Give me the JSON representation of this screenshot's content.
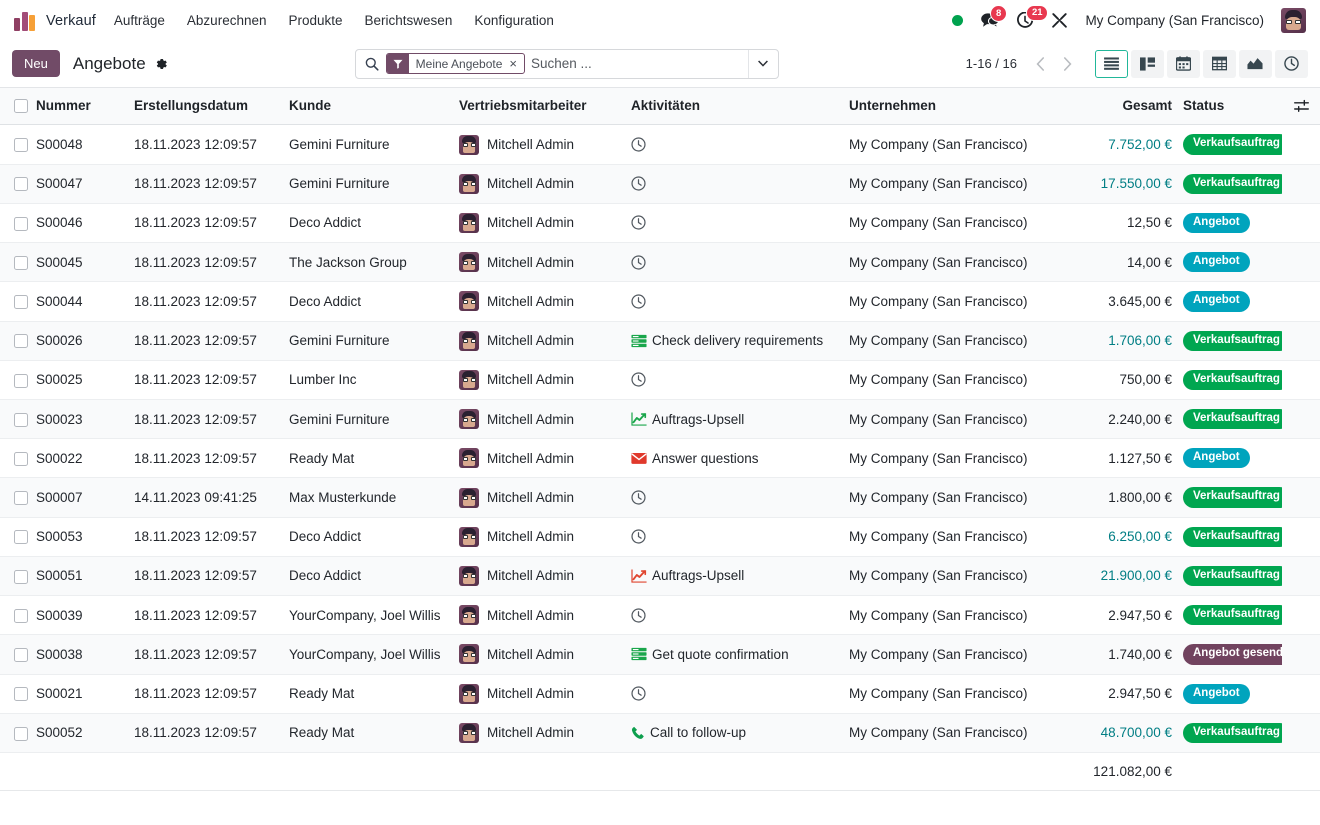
{
  "navbar": {
    "app_name": "Verkauf",
    "menu_items": [
      {
        "label": "Aufträge"
      },
      {
        "label": "Abzurechnen"
      },
      {
        "label": "Produkte"
      },
      {
        "label": "Berichtswesen"
      },
      {
        "label": "Konfiguration"
      }
    ],
    "status_dot_color": "#00a24e",
    "messages_count": "8",
    "activities_count": "21",
    "company": "My Company (San Francisco)"
  },
  "control_panel": {
    "new_button": "Neu",
    "title": "Angebote",
    "search": {
      "facet_label": "Meine Angebote",
      "facet_remove": "×",
      "placeholder": "Suchen ..."
    },
    "pager": "1-16 / 16",
    "views": [
      {
        "name": "list",
        "active": true
      },
      {
        "name": "kanban",
        "active": false
      },
      {
        "name": "calendar",
        "active": false
      },
      {
        "name": "pivot",
        "active": false
      },
      {
        "name": "graph",
        "active": false
      },
      {
        "name": "activity",
        "active": false
      }
    ]
  },
  "table": {
    "headers": {
      "number": "Nummer",
      "date": "Erstellungsdatum",
      "customer": "Kunde",
      "salesperson": "Vertriebsmitarbeiter",
      "activities": "Aktivitäten",
      "company": "Unternehmen",
      "total": "Gesamt",
      "status": "Status"
    },
    "rows": [
      {
        "number": "S00048",
        "date": "18.11.2023 12:09:57",
        "customer": "Gemini Furniture",
        "salesperson": "Mitchell Admin",
        "activity_icon": "clock-icon",
        "activity_label": "",
        "company": "My Company (San Francisco)",
        "total": "7.752,00 €",
        "total_color": "teal",
        "status": "Verkaufsauftrag",
        "status_kind": "sale"
      },
      {
        "number": "S00047",
        "date": "18.11.2023 12:09:57",
        "customer": "Gemini Furniture",
        "salesperson": "Mitchell Admin",
        "activity_icon": "clock-icon",
        "activity_label": "",
        "company": "My Company (San Francisco)",
        "total": "17.550,00 €",
        "total_color": "teal",
        "status": "Verkaufsauftrag",
        "status_kind": "sale"
      },
      {
        "number": "S00046",
        "date": "18.11.2023 12:09:57",
        "customer": "Deco Addict",
        "salesperson": "Mitchell Admin",
        "activity_icon": "clock-icon",
        "activity_label": "",
        "company": "My Company (San Francisco)",
        "total": "12,50 €",
        "total_color": "dark",
        "status": "Angebot",
        "status_kind": "quote"
      },
      {
        "number": "S00045",
        "date": "18.11.2023 12:09:57",
        "customer": "The Jackson Group",
        "salesperson": "Mitchell Admin",
        "activity_icon": "clock-icon",
        "activity_label": "",
        "company": "My Company (San Francisco)",
        "total": "14,00 €",
        "total_color": "dark",
        "status": "Angebot",
        "status_kind": "quote"
      },
      {
        "number": "S00044",
        "date": "18.11.2023 12:09:57",
        "customer": "Deco Addict",
        "salesperson": "Mitchell Admin",
        "activity_icon": "clock-icon",
        "activity_label": "",
        "company": "My Company (San Francisco)",
        "total": "3.645,00 €",
        "total_color": "dark",
        "status": "Angebot",
        "status_kind": "quote"
      },
      {
        "number": "S00026",
        "date": "18.11.2023 12:09:57",
        "customer": "Gemini Furniture",
        "salesperson": "Mitchell Admin",
        "activity_icon": "todo-list-icon-green",
        "activity_label": "Check delivery requirements",
        "company": "My Company (San Francisco)",
        "total": "1.706,00 €",
        "total_color": "teal",
        "status": "Verkaufsauftrag",
        "status_kind": "sale"
      },
      {
        "number": "S00025",
        "date": "18.11.2023 12:09:57",
        "customer": "Lumber Inc",
        "salesperson": "Mitchell Admin",
        "activity_icon": "clock-icon",
        "activity_label": "",
        "company": "My Company (San Francisco)",
        "total": "750,00 €",
        "total_color": "dark",
        "status": "Verkaufsauftrag",
        "status_kind": "sale"
      },
      {
        "number": "S00023",
        "date": "18.11.2023 12:09:57",
        "customer": "Gemini Furniture",
        "salesperson": "Mitchell Admin",
        "activity_icon": "upsell-chart-icon-green",
        "activity_label": "Auftrags-Upsell",
        "company": "My Company (San Francisco)",
        "total": "2.240,00 €",
        "total_color": "dark",
        "status": "Verkaufsauftrag",
        "status_kind": "sale"
      },
      {
        "number": "S00022",
        "date": "18.11.2023 12:09:57",
        "customer": "Ready Mat",
        "salesperson": "Mitchell Admin",
        "activity_icon": "email-icon-red",
        "activity_label": "Answer questions",
        "company": "My Company (San Francisco)",
        "total": "1.127,50 €",
        "total_color": "dark",
        "status": "Angebot",
        "status_kind": "quote"
      },
      {
        "number": "S00007",
        "date": "14.11.2023 09:41:25",
        "customer": "Max Musterkunde",
        "salesperson": "Mitchell Admin",
        "activity_icon": "clock-icon",
        "activity_label": "",
        "company": "My Company (San Francisco)",
        "total": "1.800,00 €",
        "total_color": "dark",
        "status": "Verkaufsauftrag",
        "status_kind": "sale"
      },
      {
        "number": "S00053",
        "date": "18.11.2023 12:09:57",
        "customer": "Deco Addict",
        "salesperson": "Mitchell Admin",
        "activity_icon": "clock-icon",
        "activity_label": "",
        "company": "My Company (San Francisco)",
        "total": "6.250,00 €",
        "total_color": "teal",
        "status": "Verkaufsauftrag",
        "status_kind": "sale"
      },
      {
        "number": "S00051",
        "date": "18.11.2023 12:09:57",
        "customer": "Deco Addict",
        "salesperson": "Mitchell Admin",
        "activity_icon": "upsell-chart-icon-red",
        "activity_label": "Auftrags-Upsell",
        "company": "My Company (San Francisco)",
        "total": "21.900,00 €",
        "total_color": "teal",
        "status": "Verkaufsauftrag",
        "status_kind": "sale"
      },
      {
        "number": "S00039",
        "date": "18.11.2023 12:09:57",
        "customer": "YourCompany, Joel Willis",
        "salesperson": "Mitchell Admin",
        "activity_icon": "clock-icon",
        "activity_label": "",
        "company": "My Company (San Francisco)",
        "total": "2.947,50 €",
        "total_color": "dark",
        "status": "Verkaufsauftrag",
        "status_kind": "sale"
      },
      {
        "number": "S00038",
        "date": "18.11.2023 12:09:57",
        "customer": "YourCompany, Joel Willis",
        "salesperson": "Mitchell Admin",
        "activity_icon": "todo-list-icon-green",
        "activity_label": "Get quote confirmation",
        "company": "My Company (San Francisco)",
        "total": "1.740,00 €",
        "total_color": "dark",
        "status": "Angebot gesendet",
        "status_kind": "sent"
      },
      {
        "number": "S00021",
        "date": "18.11.2023 12:09:57",
        "customer": "Ready Mat",
        "salesperson": "Mitchell Admin",
        "activity_icon": "clock-icon",
        "activity_label": "",
        "company": "My Company (San Francisco)",
        "total": "2.947,50 €",
        "total_color": "dark",
        "status": "Angebot",
        "status_kind": "quote"
      },
      {
        "number": "S00052",
        "date": "18.11.2023 12:09:57",
        "customer": "Ready Mat",
        "salesperson": "Mitchell Admin",
        "activity_icon": "phone-icon-green",
        "activity_label": "Call to follow-up",
        "company": "My Company (San Francisco)",
        "total": "48.700,00 €",
        "total_color": "teal",
        "status": "Verkaufsauftrag",
        "status_kind": "sale"
      }
    ],
    "footer_total": "121.082,00 €"
  },
  "colors": {
    "brand_purple": "#714b67",
    "sale_green": "#00a650",
    "quote_cyan": "#00a4bd",
    "sent_purple": "#71435f",
    "teal_amount": "#017e84",
    "badge_red": "#e8384f",
    "active_view": "#21b799"
  }
}
